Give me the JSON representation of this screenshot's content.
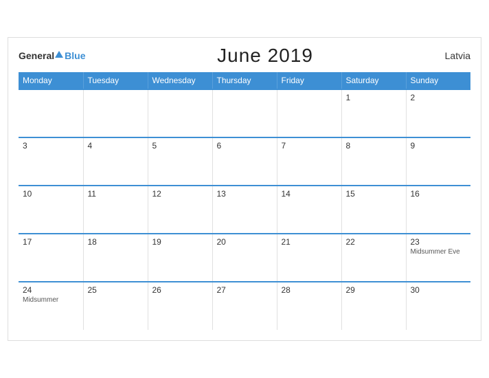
{
  "logo": {
    "general": "General",
    "blue": "Blue"
  },
  "title": "June 2019",
  "country": "Latvia",
  "weekdays": [
    "Monday",
    "Tuesday",
    "Wednesday",
    "Thursday",
    "Friday",
    "Saturday",
    "Sunday"
  ],
  "weeks": [
    [
      {
        "day": "",
        "event": "",
        "empty": true
      },
      {
        "day": "",
        "event": "",
        "empty": true
      },
      {
        "day": "",
        "event": "",
        "empty": true
      },
      {
        "day": "",
        "event": "",
        "empty": true
      },
      {
        "day": "",
        "event": "",
        "empty": true
      },
      {
        "day": "1",
        "event": ""
      },
      {
        "day": "2",
        "event": ""
      }
    ],
    [
      {
        "day": "3",
        "event": ""
      },
      {
        "day": "4",
        "event": ""
      },
      {
        "day": "5",
        "event": ""
      },
      {
        "day": "6",
        "event": ""
      },
      {
        "day": "7",
        "event": ""
      },
      {
        "day": "8",
        "event": ""
      },
      {
        "day": "9",
        "event": ""
      }
    ],
    [
      {
        "day": "10",
        "event": ""
      },
      {
        "day": "11",
        "event": ""
      },
      {
        "day": "12",
        "event": ""
      },
      {
        "day": "13",
        "event": ""
      },
      {
        "day": "14",
        "event": ""
      },
      {
        "day": "15",
        "event": ""
      },
      {
        "day": "16",
        "event": ""
      }
    ],
    [
      {
        "day": "17",
        "event": ""
      },
      {
        "day": "18",
        "event": ""
      },
      {
        "day": "19",
        "event": ""
      },
      {
        "day": "20",
        "event": ""
      },
      {
        "day": "21",
        "event": ""
      },
      {
        "day": "22",
        "event": ""
      },
      {
        "day": "23",
        "event": "Midsummer Eve"
      }
    ],
    [
      {
        "day": "24",
        "event": "Midsummer"
      },
      {
        "day": "25",
        "event": ""
      },
      {
        "day": "26",
        "event": ""
      },
      {
        "day": "27",
        "event": ""
      },
      {
        "day": "28",
        "event": ""
      },
      {
        "day": "29",
        "event": ""
      },
      {
        "day": "30",
        "event": ""
      }
    ]
  ]
}
